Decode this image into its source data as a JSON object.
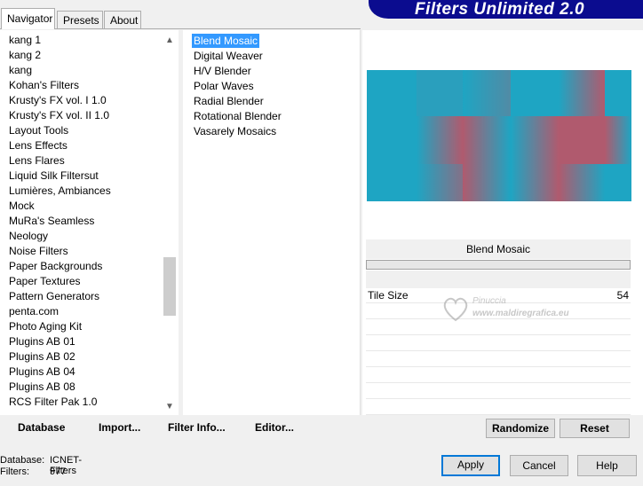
{
  "banner": {
    "title": "Filters Unlimited 2.0"
  },
  "tabs": [
    {
      "label": "Navigator",
      "active": true
    },
    {
      "label": "Presets",
      "active": false
    },
    {
      "label": "About",
      "active": false
    }
  ],
  "categories": {
    "items": [
      "kang 1",
      "kang 2",
      "kang",
      "Kohan's Filters",
      "Krusty's FX vol. I 1.0",
      "Krusty's FX vol. II 1.0",
      "Layout Tools",
      "Lens Effects",
      "Lens Flares",
      "Liquid Silk Filtersut",
      "Lumières, Ambiances",
      "Mock",
      "MuRa's Seamless",
      "Neology",
      "Noise Filters",
      "Paper Backgrounds",
      "Paper Textures",
      "Pattern Generators",
      "penta.com",
      "Photo Aging Kit",
      "Plugins AB 01",
      "Plugins AB 02",
      "Plugins AB 04",
      "Plugins AB 08",
      "RCS Filter Pak 1.0"
    ],
    "selected": "Neology"
  },
  "filters": {
    "items": [
      "Blend Mosaic",
      "Digital Weaver",
      "H/V Blender",
      "Polar Waves",
      "Radial Blender",
      "Rotational Blender",
      "Vasarely Mosaics"
    ],
    "selected": "Blend Mosaic"
  },
  "preview": {
    "colors": {
      "teal": "#1ea5c3",
      "rose": "#b05a6e"
    }
  },
  "filter_panel": {
    "name": "Blend Mosaic",
    "params": [
      {
        "label": "Tile Size",
        "value": "54"
      }
    ]
  },
  "watermark": {
    "name": "Pinuccia",
    "url": "www.maldiregrafica.eu"
  },
  "bottom_left": {
    "database": "Database",
    "import": "Import...",
    "filter_info": "Filter Info...",
    "editor": "Editor..."
  },
  "actions": {
    "randomize": "Randomize",
    "reset": "Reset"
  },
  "status": {
    "database_label": "Database:",
    "database_value": "ICNET-Filters",
    "filters_label": "Filters:",
    "filters_value": "977"
  },
  "dialog_buttons": {
    "apply": "Apply",
    "cancel": "Cancel",
    "help": "Help"
  },
  "accent_color": "#0078d7",
  "banner_color": "#0b0c8f"
}
